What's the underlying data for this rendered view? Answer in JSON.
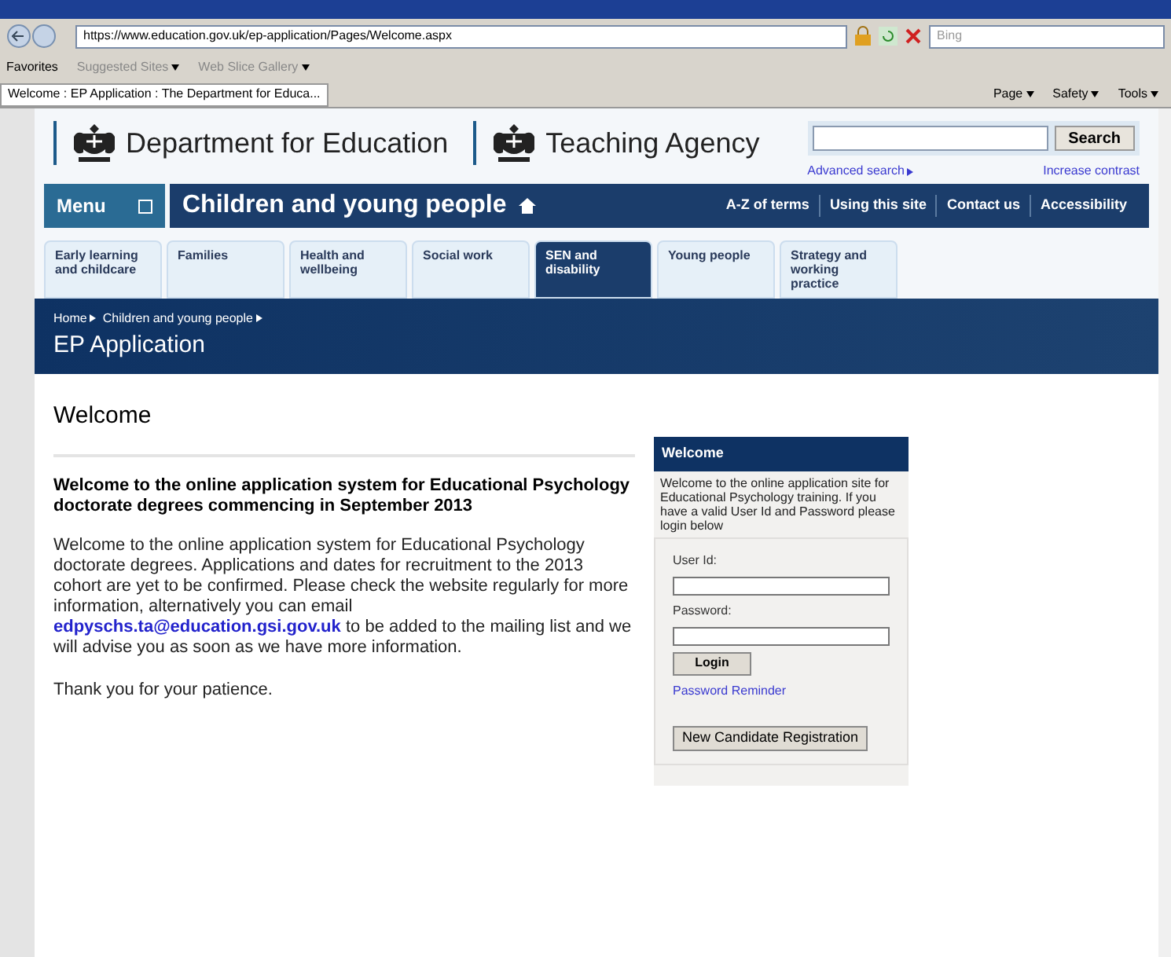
{
  "browser": {
    "address": "https://www.education.gov.uk/ep-application/Pages/Welcome.aspx",
    "search_placeholder": "Bing",
    "favorites": [
      {
        "label": "Favorites",
        "kind": "star"
      },
      {
        "label": "Suggested Sites",
        "kind": "dropdown"
      },
      {
        "label": "Web Slice Gallery",
        "kind": "dropdown"
      }
    ],
    "tab": "Welcome : EP Application : The Department for Educa...",
    "commands": [
      "Page",
      "Safety",
      "Tools"
    ]
  },
  "header": {
    "logos": [
      "Department for Education",
      "Teaching Agency"
    ],
    "search_button": "Search",
    "advanced_search": "Advanced search",
    "increase_contrast": "Increase contrast"
  },
  "nav": {
    "menu": "Menu",
    "section": "Children and young people",
    "links": [
      "A-Z of terms",
      "Using this site",
      "Contact us",
      "Accessibility"
    ]
  },
  "tabs": [
    {
      "label": "Early learning and childcare",
      "selected": false
    },
    {
      "label": "Families",
      "selected": false
    },
    {
      "label": "Health and wellbeing",
      "selected": false
    },
    {
      "label": "Social work",
      "selected": false
    },
    {
      "label": "SEN and disability",
      "selected": true
    },
    {
      "label": "Young people",
      "selected": false
    },
    {
      "label": "Strategy and working practice",
      "selected": false
    }
  ],
  "banner": {
    "breadcrumbs": [
      "Home",
      "Children and young people"
    ],
    "title": "EP Application"
  },
  "main": {
    "heading": "Welcome",
    "intro": "Welcome to the online application system for Educational Psychology doctorate degrees commencing in September 2013",
    "body_before": "Welcome to the online application system for Educational Psychology doctorate degrees. Applications and dates for recruitment to the 2013 cohort are yet to be confirmed. Please check the website regularly for more information, alternatively you can email",
    "email": "edpyschs.ta@education.gsi.gov.uk",
    "body_after": "to be added to the mailing list and we will advise you as soon as we have more information.",
    "thanks": "Thank you for your patience."
  },
  "login": {
    "title": "Welcome",
    "text": "Welcome to the online application site for Educational Psychology training. If you have a valid User Id and Password please login below",
    "user_label": "User Id:",
    "password_label": "Password:",
    "login_button": "Login",
    "reminder": "Password Reminder",
    "register_button": "New Candidate Registration"
  }
}
